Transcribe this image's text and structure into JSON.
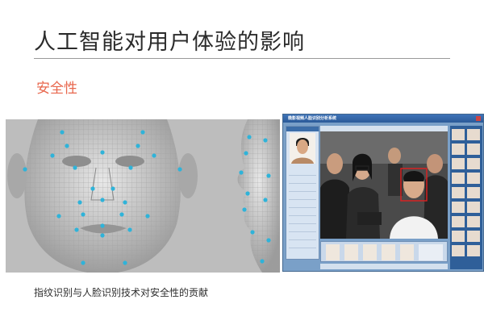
{
  "slide": {
    "title": "人工智能对用户体验的影响",
    "subtitle": "安全性",
    "caption": "指纹识别与人脸识别技术对安全性的贡献"
  },
  "software": {
    "window_title": "微影视频人脸识别分析系统"
  },
  "colors": {
    "accent": "#e8674d",
    "title": "#2b2b2b",
    "rule": "#9a9a9a",
    "window_frame": "#2b5a98"
  }
}
